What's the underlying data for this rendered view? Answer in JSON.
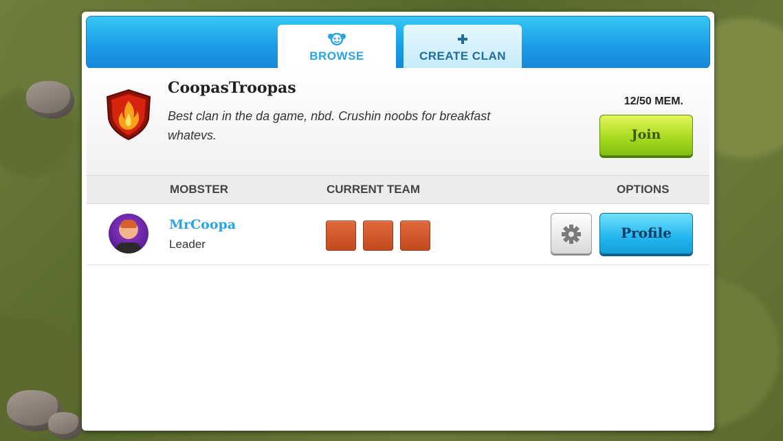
{
  "tabs": {
    "browse": {
      "label": "BROWSE",
      "icon": "people-icon"
    },
    "create": {
      "label": "CREATE CLAN",
      "icon": "plus-icon"
    }
  },
  "clan": {
    "name": "CoopasTroopas",
    "description": "Best clan in the da game, nbd.  Crushin noobs for breakfast whatevs.",
    "members": "12/50 MEM.",
    "join_label": "Join",
    "emblem_icon": "flame-shield-icon"
  },
  "columns": {
    "mobster": "MOBSTER",
    "team": "CURRENT TEAM",
    "options": "OPTIONS"
  },
  "members_list": [
    {
      "name": "MrCoopa",
      "role": "Leader",
      "team_slots": 3,
      "settings_icon": "gear-icon",
      "profile_label": "Profile"
    }
  ],
  "colors": {
    "accent_blue": "#2aa4e4",
    "join_green": "#a6d81e",
    "slot_orange": "#d0582a"
  }
}
